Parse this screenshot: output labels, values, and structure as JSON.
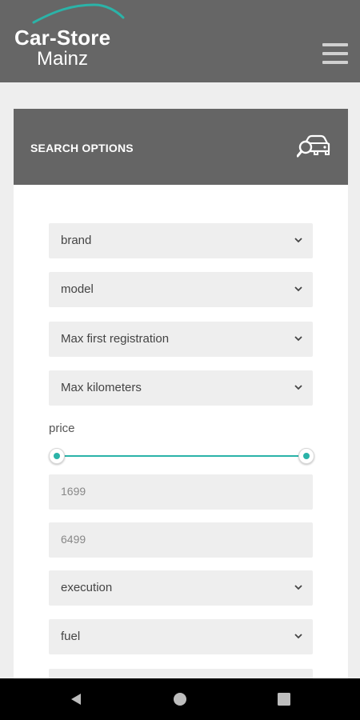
{
  "header": {
    "logo_line1": "Car-Store",
    "logo_line2": "Mainz",
    "menu_icon": "hamburger-icon"
  },
  "search": {
    "title": "SEARCH OPTIONS",
    "icon": "car-search-icon",
    "fields": {
      "brand": "brand",
      "model": "model",
      "first_registration": "Max first registration",
      "kilometers": "Max kilometers",
      "execution": "execution",
      "fuel": "fuel"
    },
    "price": {
      "label": "price",
      "min_value": "1699",
      "max_value": "6499",
      "range_start_fraction": 0,
      "range_end_fraction": 1
    }
  },
  "navigation": {
    "back_icon": "back-triangle-icon",
    "home_icon": "home-circle-icon",
    "recents_icon": "recents-square-icon"
  },
  "colors": {
    "header_bg": "#666666",
    "accent": "#2bb3a8",
    "field_bg": "#eeeeee"
  }
}
